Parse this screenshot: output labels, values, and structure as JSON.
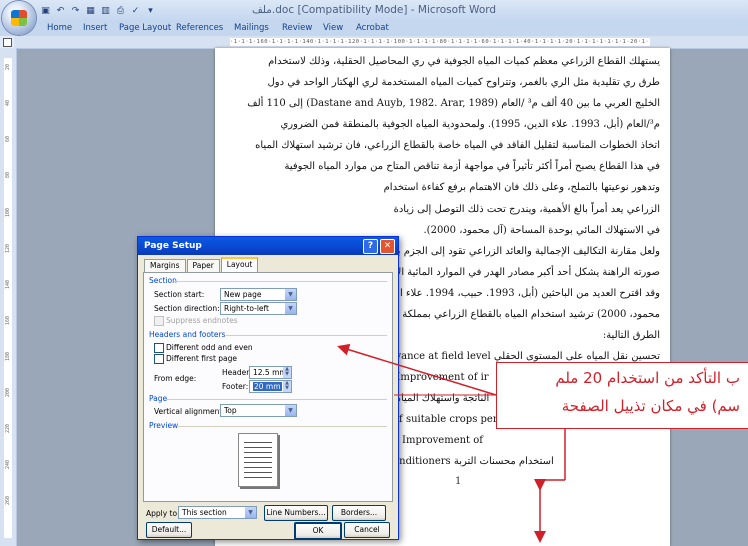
{
  "window": {
    "title": "ملف.doc [Compatibility Mode] - Microsoft Word"
  },
  "ribbon_tabs": [
    "Home",
    "Insert",
    "Page Layout",
    "References",
    "Mailings",
    "Review",
    "View",
    "Acrobat"
  ],
  "ruler": {
    "horizontal_text": "·1·1·1·160·1·1·1·1·140·1·1·1·1·120·1·1·1·1·100·1·1·1·1·80·1·1·1·1·60·1·1·1·1·40·1·1·1·1·20·1·1·1·1·1·1·1·20·1·1·",
    "vertical_ticks": [
      "20",
      "40",
      "60",
      "80",
      "100",
      "120",
      "140",
      "160",
      "180",
      "200",
      "220",
      "240",
      "260"
    ]
  },
  "document": {
    "lines": [
      "يستهلك القطاع الزراعي معظم كميات المياه الجوفية في ري المحاصيل الحقلية، وذلك لاستخدام",
      "طرق ري تقليدية مثل الري بالغمر، وتتراوح كميات المياه المستخدمة لري الهكتار الواحد في دول",
      "الخليج العربي ما بين 40 ألف م³ /العام (Dastane and Auyb, 1982. Arar, 1989) إلى 110 ألف",
      "م³/العام (أبل، 1993. علاء الدين، 1995). ولمحدودية المياه الجوفية بالمنطقة فمن الضروري",
      "اتخاذ الخطوات المناسبة لتقليل الفاقد في المياه خاصة بالقطاع الزراعي، فان ترشيد استهلاك المياه",
      "في هذا القطاع يصبح أمراً أكثر تأثيراً في مواجهة أزمة تناقص المتاح من موارد المياه الجوفية",
      "وتدهور نوعيتها بالتملح، وعلى ذلك فان الاهتمام برفع كفاءة استخدام",
      "الزراعي يعد أمراً بالغ الأهمية، ويندرج تحت ذلك التوصل إلى زيادة",
      "في الاستهلاك المائي بوحدة المساحة (آل محمود، 2000).",
      "ولعل مقارنة التكاليف الإجمالية والعائد الزراعي تقود إلى الجزم بأن",
      "صورته الراهنة يشكل أحد أكبر مصادر الهدر في الموارد المائية الإ",
      "وقد اقترح العديد من الباحثين (أبل، 1993. حبيب، 1994. علاء الدين",
      "محمود، 2000) ترشيد استخدام المياه بالقطاع الزراعي بمملكة البحرين",
      "الطرق التالية:",
      "تحسين نقل المياه على المستوى الحقلي conveyance at field level"
    ],
    "center_lines": [
      "Improvement of ir",
      "الناتجة واستهلاك المياه",
      "ion of suitable crops pertai",
      "Improvement of",
      "Use of soil conditioners استخدام محسنات التربة"
    ],
    "page_number": "1"
  },
  "dialog": {
    "title": "Page Setup",
    "help": "?",
    "close": "✕",
    "tabs": [
      "Margins",
      "Paper",
      "Layout"
    ],
    "active_tab": "Layout",
    "section_group": "Section",
    "section_start_label": "Section start:",
    "section_start_value": "New page",
    "section_direction_label": "Section direction:",
    "section_direction_value": "Right-to-left",
    "suppress_endnotes": "Suppress endnotes",
    "headers_group": "Headers and footers",
    "different_odd_even": "Different odd and even",
    "different_first_page": "Different first page",
    "from_edge_label": "From edge:",
    "header_label": "Header:",
    "header_value": "12.5 mm",
    "footer_label": "Footer:",
    "footer_value": "20 mm",
    "page_group": "Page",
    "vertical_alignment_label": "Vertical alignment:",
    "vertical_alignment_value": "Top",
    "preview_group": "Preview",
    "apply_to_label": "Apply to:",
    "apply_to_value": "This section",
    "line_numbers_button": "Line Numbers...",
    "borders_button": "Borders...",
    "default_button": "Default...",
    "ok_button": "OK",
    "cancel_button": "Cancel"
  },
  "callout": {
    "line1": "ب التأكد من استخدام 20 ملم",
    "line2": "سم) في مكان تذييل الصفحة",
    "color": "#d0202a"
  }
}
